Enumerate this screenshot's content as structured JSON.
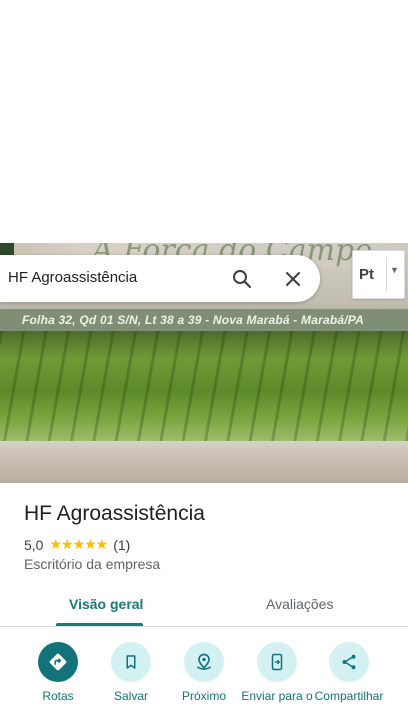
{
  "search": {
    "query": "HF Agroassistência"
  },
  "language": {
    "selected": "Pt"
  },
  "photo": {
    "slogan": "A Força do Campo",
    "address": "Folha 32, Qd 01 S/N, Lt 38 a 39 - Nova Marabá - Marabá/PA"
  },
  "place": {
    "name": "HF Agroassistência",
    "rating": "5,0",
    "stars": "★★★★★",
    "review_count": "(1)",
    "category": "Escritório da empresa"
  },
  "tabs": [
    {
      "label": "Visão geral",
      "selected": true
    },
    {
      "label": "Avaliações",
      "selected": false
    }
  ],
  "actions": [
    {
      "label": "Rotas",
      "icon": "directions-icon"
    },
    {
      "label": "Salvar",
      "icon": "bookmark-icon"
    },
    {
      "label": "Próximo",
      "icon": "nearby-icon"
    },
    {
      "label": "Enviar para o",
      "icon": "send-to-phone-icon"
    },
    {
      "label": "Compartilhar",
      "icon": "share-icon"
    }
  ],
  "colors": {
    "accent": "#13727a",
    "accent_light": "#d3f1f2",
    "star": "#fbbc04"
  }
}
